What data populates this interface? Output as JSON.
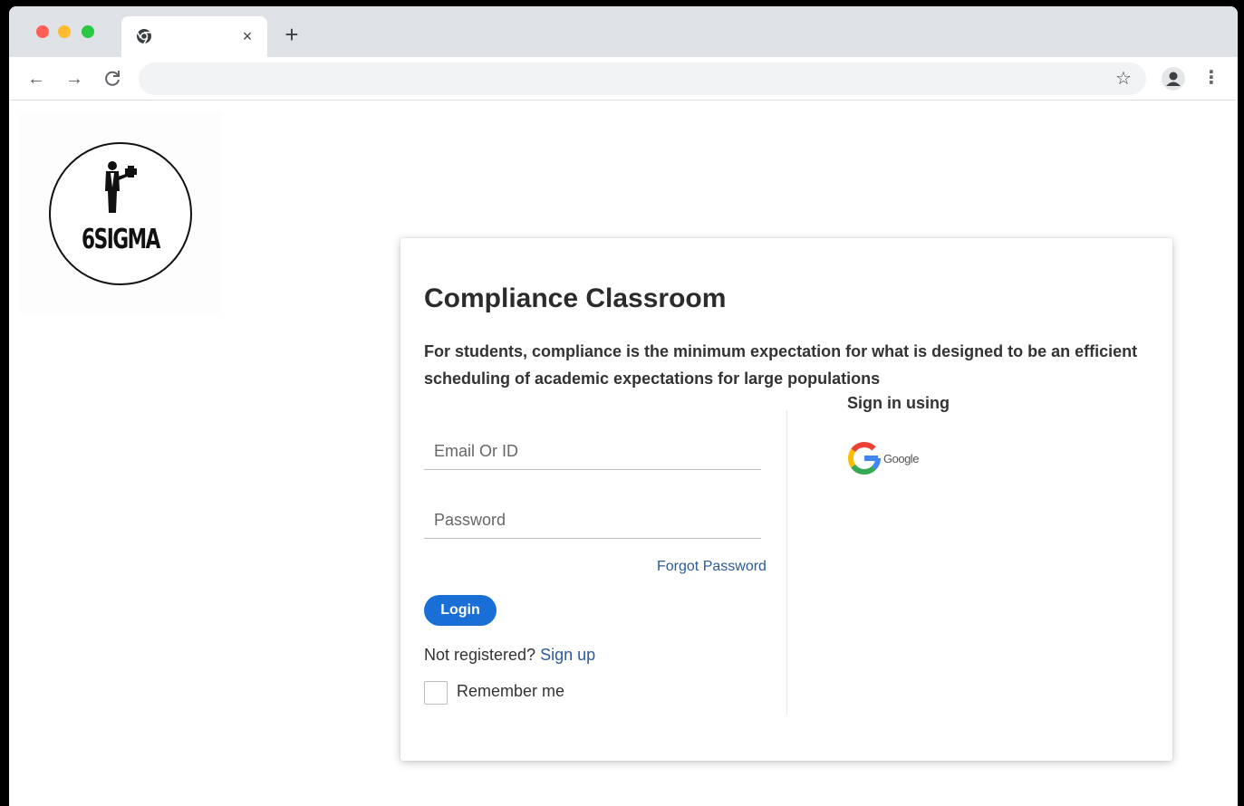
{
  "browser": {
    "tab_close": "×",
    "new_tab": "+",
    "nav": {
      "back": "←",
      "forward": "→",
      "reload": "C"
    },
    "address": "",
    "star": "☆",
    "menu": "⋮"
  },
  "logo": {
    "text": "6SIGMA"
  },
  "card": {
    "title": "Compliance Classroom",
    "description": "For students, compliance is the minimum expectation for what is designed to be an efficient scheduling of academic expectations for large populations",
    "email_placeholder": "Email Or ID",
    "password_placeholder": "Password",
    "forgot_password": "Forgot Password",
    "login_label": "Login",
    "not_registered": "Not registered?",
    "sign_up": "Sign up",
    "remember_me": "Remember me",
    "sign_in_using": "Sign in using",
    "google_label": "Google"
  },
  "colors": {
    "primary": "#1a6fd6",
    "link": "#2c5a9a",
    "tabstrip": "#dee1e6"
  }
}
